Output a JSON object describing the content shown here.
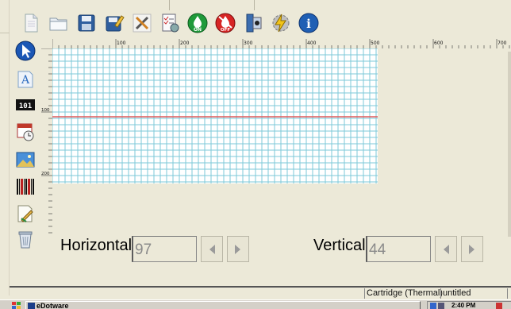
{
  "toolbar": {
    "buttons": [
      {
        "name": "new-document-icon"
      },
      {
        "name": "open-folder-icon"
      },
      {
        "name": "save-icon"
      },
      {
        "name": "save-as-icon"
      },
      {
        "name": "tools-icon"
      },
      {
        "name": "settings-checklist-icon"
      },
      {
        "name": "ink-on-icon",
        "label": "ON"
      },
      {
        "name": "ink-off-icon",
        "label": "OFF"
      },
      {
        "name": "print-preview-icon"
      },
      {
        "name": "flash-settings-icon"
      },
      {
        "name": "info-icon",
        "label": "i"
      }
    ]
  },
  "sidebar": {
    "tools": [
      {
        "name": "select-arrow-icon"
      },
      {
        "name": "text-tool-icon",
        "label": "A"
      },
      {
        "name": "counter-tool-icon",
        "label": "10 1"
      },
      {
        "name": "date-time-tool-icon"
      },
      {
        "name": "image-tool-icon"
      },
      {
        "name": "barcode-tool-icon"
      },
      {
        "name": "edit-object-icon"
      },
      {
        "name": "delete-trash-icon"
      }
    ]
  },
  "ruler": {
    "top_ticks": [
      "100",
      "200",
      "300",
      "400",
      "500",
      "600",
      "700"
    ],
    "left_ticks": [
      "100",
      "200"
    ]
  },
  "position": {
    "horizontal_label": "Horizontal",
    "horizontal_value": "97",
    "vertical_label": "Vertical",
    "vertical_value": "44"
  },
  "status": {
    "cartridge": "Cartridge (Thermal)",
    "file": "untitled"
  },
  "taskbar": {
    "app_title": "eDotware",
    "clock": "2:40 PM"
  },
  "colors": {
    "grid_line": "#7ec8d8",
    "grid_bg": "#ffffff",
    "guide_line": "#e05a5a"
  }
}
